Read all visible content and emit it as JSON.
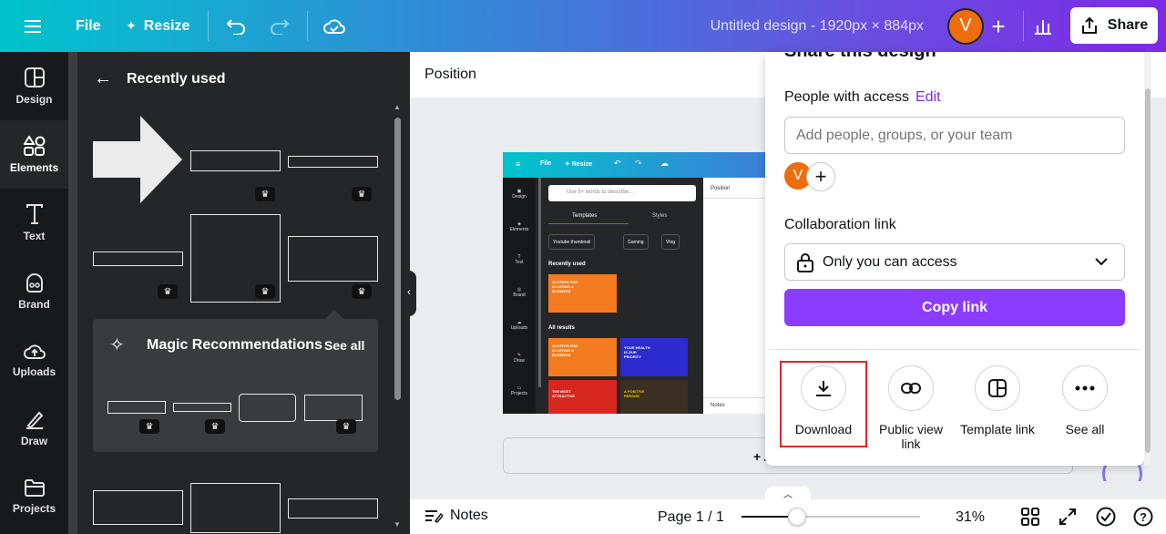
{
  "topbar": {
    "menu_label": "File",
    "resize_label": "Resize",
    "design_title": "Untitled design - 1920px × 884px",
    "avatar_initial": "V",
    "share_label": "Share"
  },
  "rail": {
    "items": [
      {
        "label": "Design",
        "icon": "design-icon"
      },
      {
        "label": "Elements",
        "icon": "elements-icon",
        "active": true
      },
      {
        "label": "Text",
        "icon": "text-icon"
      },
      {
        "label": "Brand",
        "icon": "brand-icon"
      },
      {
        "label": "Uploads",
        "icon": "uploads-icon"
      },
      {
        "label": "Draw",
        "icon": "draw-icon"
      },
      {
        "label": "Projects",
        "icon": "projects-icon"
      }
    ]
  },
  "panel": {
    "title": "Recently used",
    "magic_title": "Magic Recommendations",
    "magic_see_all": "See all"
  },
  "canvas": {
    "toolbar_label": "Position",
    "add_page_label": "+ A"
  },
  "mini_preview": {
    "file": "File",
    "resize": "Resize",
    "search_placeholder": "Use 5+ words to describe...",
    "tabs": [
      "Templates",
      "Styles"
    ],
    "chips": [
      "Youtube thumbnail",
      "Gaming",
      "Vlog"
    ],
    "recently_used": "Recently used",
    "all_results": "All results",
    "position": "Position",
    "notes": "Notes",
    "rail": [
      "Design",
      "Elements",
      "Text",
      "Brand",
      "Uploads",
      "Draw",
      "Projects"
    ],
    "thumb_texts": [
      "10 STEPS FOR STARTING A BUSINESS",
      "YOUR HEALTH IS OUR PRIORITY",
      "THE MOST ATTRACTIVE",
      "A POSITIVE PERSON"
    ]
  },
  "share": {
    "title": "Share this design",
    "people_label": "People with access",
    "edit_label": "Edit",
    "add_people_placeholder": "Add people, groups, or your team",
    "avatar_initial": "V",
    "collab_label": "Collaboration link",
    "access_value": "Only you can access",
    "copy_link": "Copy link",
    "options": [
      {
        "label": "Download",
        "icon": "download-icon"
      },
      {
        "label": "Public view link",
        "icon": "link-icon"
      },
      {
        "label": "Template link",
        "icon": "template-icon"
      },
      {
        "label": "See all",
        "icon": "more-icon"
      }
    ]
  },
  "bottombar": {
    "notes_label": "Notes",
    "page_label": "Page 1 / 1",
    "zoom_value": "31%",
    "zoom_fraction": 0.31
  },
  "colors": {
    "accent": "#8b3dff",
    "edit_link": "#7d2ae8",
    "highlight_border": "#e3262a",
    "avatar": "#ee6d0d"
  }
}
